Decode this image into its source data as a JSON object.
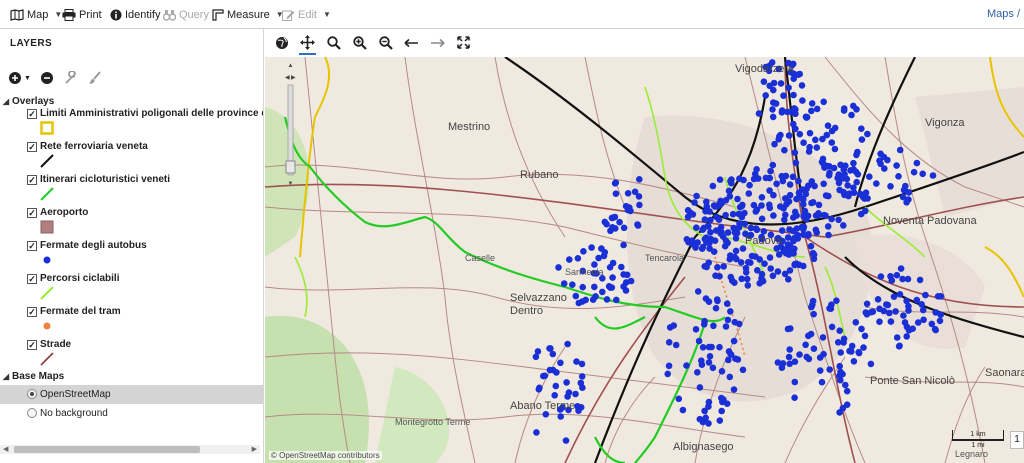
{
  "toolbar": {
    "map_label": "Map",
    "print_label": "Print",
    "identify_label": "Identify",
    "query_label": "Query",
    "measure_label": "Measure",
    "edit_label": "Edit",
    "breadcrumb": "Maps /"
  },
  "sidebar": {
    "title": "LAYERS",
    "overlays_label": "Overlays",
    "layers": [
      {
        "name": "Limiti Amministrativi poligonali delle province della",
        "checked": true,
        "symbol": "yellow-square-icon",
        "color": "#e8c400"
      },
      {
        "name": "Rete ferroviaria veneta",
        "checked": true,
        "symbol": "black-line-icon",
        "color": "#111111"
      },
      {
        "name": "Itinerari cicloturistici veneti",
        "checked": true,
        "symbol": "green-line-icon",
        "color": "#22cc22"
      },
      {
        "name": "Aeroporto",
        "checked": true,
        "symbol": "brown-square-icon",
        "color": "#b08080"
      },
      {
        "name": "Fermate degli autobus",
        "checked": true,
        "symbol": "blue-dot-icon",
        "color": "#1a2fd6"
      },
      {
        "name": "Percorsi ciclabili",
        "checked": true,
        "symbol": "lightgreen-line-icon",
        "color": "#99ee33"
      },
      {
        "name": "Fermate del tram",
        "checked": true,
        "symbol": "orange-dot-icon",
        "color": "#f08040"
      },
      {
        "name": "Strade",
        "checked": true,
        "symbol": "maroon-line-icon",
        "color": "#8a3a3a"
      }
    ],
    "basemaps_label": "Base Maps",
    "basemaps": [
      {
        "name": "OpenStreetMap",
        "selected": true
      },
      {
        "name": "No background",
        "selected": false
      }
    ]
  },
  "map": {
    "attribution": "© OpenStreetMap contributors",
    "scale_km": "1 km",
    "scale_mi": "1 mi",
    "zoom_value": "1",
    "places": [
      {
        "label": "Vigonza"
      },
      {
        "label": "Vigodarzere"
      },
      {
        "label": "Mestrino"
      },
      {
        "label": "Rubano"
      },
      {
        "label": "Noventa Padovana"
      },
      {
        "label": "Selvazzano Dentro"
      },
      {
        "label": "Abano Terme"
      },
      {
        "label": "Albignasego"
      },
      {
        "label": "Ponte San Nicolò"
      },
      {
        "label": "Saonara"
      },
      {
        "label": "Sarmeola"
      },
      {
        "label": "Caselle"
      },
      {
        "label": "Tencarola"
      },
      {
        "label": "Montegrotto Terme"
      },
      {
        "label": "Legnaro"
      },
      {
        "label": "Padova"
      }
    ]
  },
  "colors": {
    "accent": "#2f6fbf",
    "bus_stop": "#1a2fd6",
    "cycle": "#22cc22",
    "rail": "#111111"
  }
}
